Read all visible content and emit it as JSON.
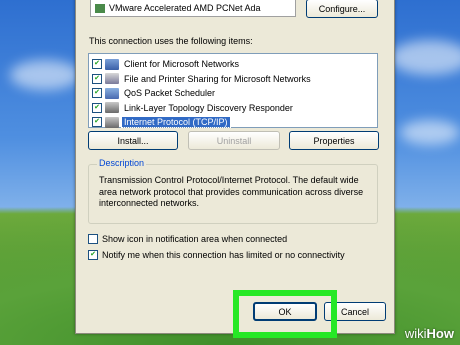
{
  "adapter": {
    "name": "VMware Accelerated AMD PCNet Ada",
    "configure_label": "Configure..."
  },
  "items_heading": "This connection uses the following items:",
  "items": [
    {
      "label": "Client for Microsoft Networks",
      "checked": true,
      "selected": false,
      "icon": "network-client-icon"
    },
    {
      "label": "File and Printer Sharing for Microsoft Networks",
      "checked": true,
      "selected": false,
      "icon": "file-printer-sharing-icon"
    },
    {
      "label": "QoS Packet Scheduler",
      "checked": true,
      "selected": false,
      "icon": "qos-scheduler-icon"
    },
    {
      "label": "Link-Layer Topology Discovery Responder",
      "checked": true,
      "selected": false,
      "icon": "protocol-icon"
    },
    {
      "label": "Internet Protocol (TCP/IP)",
      "checked": true,
      "selected": true,
      "icon": "protocol-icon"
    }
  ],
  "buttons": {
    "install": "Install...",
    "uninstall": "Uninstall",
    "properties": "Properties",
    "ok": "OK",
    "cancel": "Cancel"
  },
  "description": {
    "title": "Description",
    "text": "Transmission Control Protocol/Internet Protocol. The default wide area network protocol that provides communication across diverse interconnected networks."
  },
  "options": {
    "show_icon": {
      "label": "Show icon in notification area when connected",
      "checked": false
    },
    "notify": {
      "label": "Notify me when this connection has limited or no connectivity",
      "checked": true
    }
  },
  "watermark": {
    "wiki": "wiki",
    "how": "How"
  },
  "colors": {
    "selection": "#316ac5",
    "highlight_frame": "#26e826",
    "dialog_bg": "#ece9d8"
  }
}
